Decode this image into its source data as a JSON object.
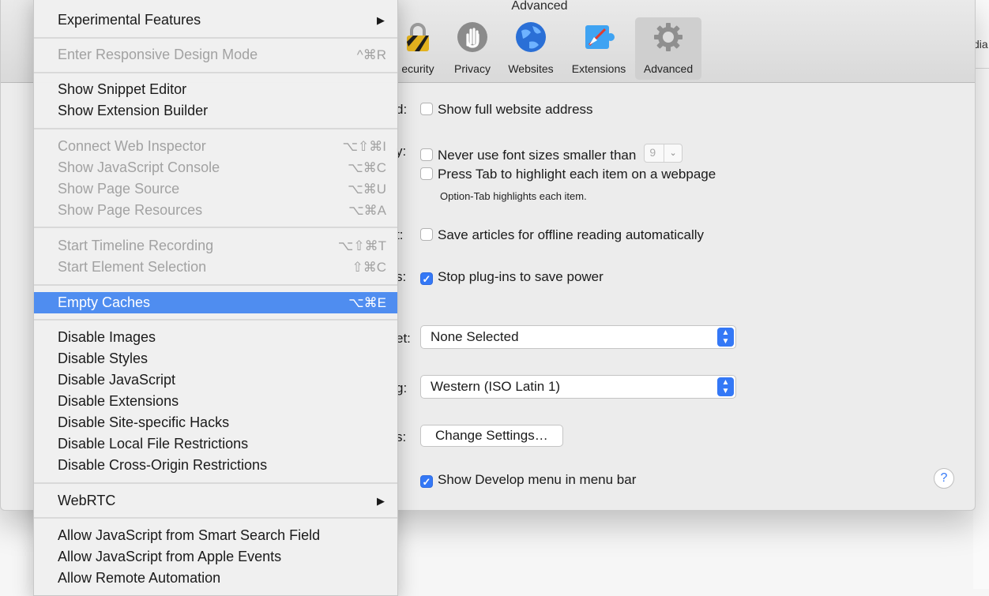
{
  "background": {
    "edge_text": "dia"
  },
  "prefs": {
    "title": "Advanced",
    "toolbar": [
      {
        "id": "security",
        "label": "ecurity",
        "icon": "lock-icon"
      },
      {
        "id": "privacy",
        "label": "Privacy",
        "icon": "hand-icon"
      },
      {
        "id": "websites",
        "label": "Websites",
        "icon": "globe-icon"
      },
      {
        "id": "extensions",
        "label": "Extensions",
        "icon": "puzzle-icon"
      },
      {
        "id": "advanced",
        "label": "Advanced",
        "icon": "gear-icon",
        "active": true
      }
    ],
    "labels": {
      "smart_search": "d:",
      "accessibility": "y:",
      "reading_list": "t:",
      "internet_plugins": "s:",
      "style_sheet": "et:",
      "encoding": "g:",
      "proxies": "s:"
    },
    "options": {
      "full_address": {
        "label": "Show full website address",
        "checked": false
      },
      "min_font": {
        "label": "Never use font sizes smaller than",
        "checked": false,
        "value": "9"
      },
      "tab_highlight": {
        "label": "Press Tab to highlight each item on a webpage",
        "checked": false
      },
      "tab_note": "Option-Tab highlights each item.",
      "offline_reading": {
        "label": "Save articles for offline reading automatically",
        "checked": false
      },
      "stop_plugins": {
        "label": "Stop plug-ins to save power",
        "checked": true
      },
      "develop_menu": {
        "label": "Show Develop menu in menu bar",
        "checked": true
      }
    },
    "style_sheet_value": "None Selected",
    "encoding_value": "Western (ISO Latin 1)",
    "proxies_button": "Change Settings…",
    "help": "?"
  },
  "menu": {
    "items": [
      {
        "label": "Experimental Features",
        "submenu": true
      },
      {
        "label": "Enter Responsive Design Mode",
        "shortcut": "^⌘R",
        "disabled": true
      },
      {
        "label": "Show Snippet Editor"
      },
      {
        "label": "Show Extension Builder"
      },
      {
        "label": "Connect Web Inspector",
        "shortcut": "⌥⇧⌘I",
        "disabled": true
      },
      {
        "label": "Show JavaScript Console",
        "shortcut": "⌥⌘C",
        "disabled": true
      },
      {
        "label": "Show Page Source",
        "shortcut": "⌥⌘U",
        "disabled": true
      },
      {
        "label": "Show Page Resources",
        "shortcut": "⌥⌘A",
        "disabled": true
      },
      {
        "label": "Start Timeline Recording",
        "shortcut": "⌥⇧⌘T",
        "disabled": true
      },
      {
        "label": "Start Element Selection",
        "shortcut": "⇧⌘C",
        "disabled": true
      },
      {
        "label": "Empty Caches",
        "shortcut": "⌥⌘E",
        "highlighted": true
      },
      {
        "label": "Disable Images"
      },
      {
        "label": "Disable Styles"
      },
      {
        "label": "Disable JavaScript"
      },
      {
        "label": "Disable Extensions"
      },
      {
        "label": "Disable Site-specific Hacks"
      },
      {
        "label": "Disable Local File Restrictions"
      },
      {
        "label": "Disable Cross-Origin Restrictions"
      },
      {
        "label": "WebRTC",
        "submenu": true
      },
      {
        "label": "Allow JavaScript from Smart Search Field"
      },
      {
        "label": "Allow JavaScript from Apple Events"
      },
      {
        "label": "Allow Remote Automation"
      }
    ],
    "colors": {
      "highlight": "#4f8df0",
      "disabled_text": "#a2a2a2"
    }
  }
}
